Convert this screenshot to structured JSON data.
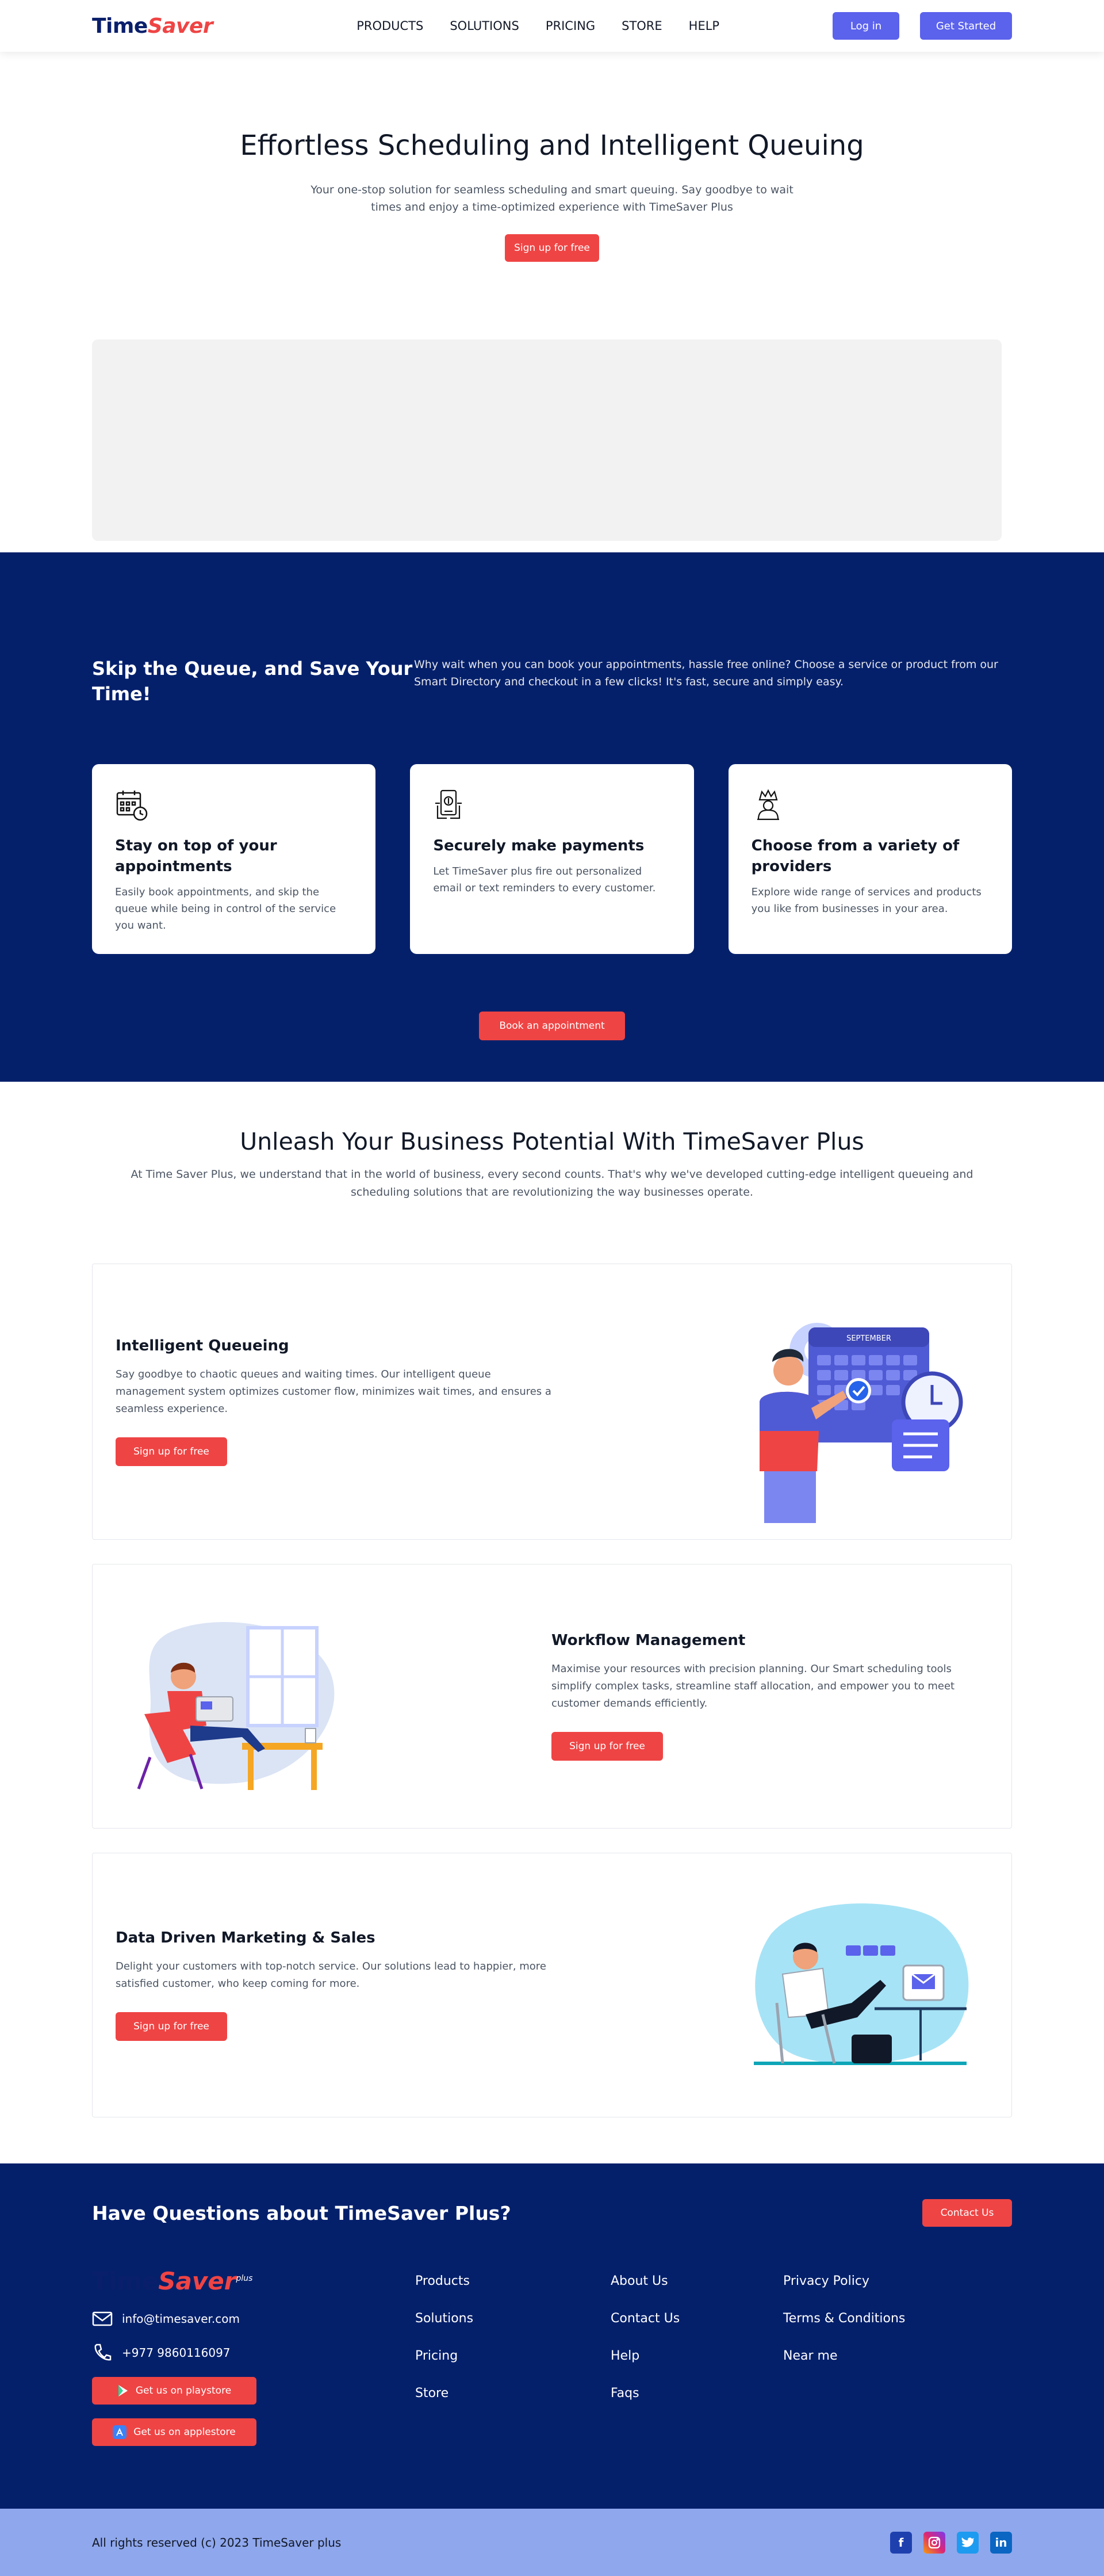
{
  "brand": {
    "part1": "Time",
    "part2": "Saver",
    "suffix": "plus"
  },
  "nav": {
    "items": [
      "PRODUCTS",
      "SOLUTIONS",
      "PRICING",
      "STORE",
      "HELP"
    ],
    "login": "Log in",
    "get_started": "Get Started"
  },
  "hero": {
    "title": "Effortless Scheduling and Intelligent Queuing",
    "subtitle": "Your one-stop solution for seamless scheduling and smart queuing. Say goodbye to wait times and enjoy a time-optimized experience with TimeSaver Plus",
    "cta": "Sign up for free"
  },
  "band": {
    "title": "Skip the Queue, and Save Your Time!",
    "description": "Why wait when you can book your appointments, hassle free online? Choose a service or product from our Smart Directory and checkout in a few clicks! It's fast, secure and simply easy.",
    "cards": [
      {
        "title": "Stay on top of your appointments",
        "text": "Easily book appointments, and skip the queue while being in control of the service you want.",
        "icon": "calendar-clock-icon"
      },
      {
        "title": "Securely make payments",
        "text": "Let TimeSaver plus fire out personalized email or text reminders to every customer.",
        "icon": "secure-payment-icon"
      },
      {
        "title": "Choose from a variety of providers",
        "text": "Explore wide range of services and products you like from businesses in your area.",
        "icon": "provider-icon"
      }
    ],
    "cta": "Book an appointment"
  },
  "unleash": {
    "title": "Unleash Your Business Potential With TimeSaver Plus",
    "subtitle": "At Time Saver Plus, we understand that in the world of business, every second counts. That's why we've developed cutting-edge intelligent queueing and scheduling solutions that are revolutionizing the way businesses operate."
  },
  "features": [
    {
      "title": "Intelligent Queueing",
      "text": "Say goodbye to chaotic queues and waiting times. Our intelligent queue management system optimizes customer flow, minimizes wait times, and ensures a seamless experience.",
      "cta": "Sign up for free"
    },
    {
      "title": "Workflow Management",
      "text": "Maximise your resources with precision planning. Our Smart scheduling tools simplify complex tasks, streamline staff allocation, and empower you to meet customer demands efficiently.",
      "cta": "Sign up for free"
    },
    {
      "title": "Data Driven Marketing & Sales",
      "text": "Delight your customers with top-notch service. Our solutions lead to happier, more satisfied customer, who keep coming for more.",
      "cta": "Sign up for free"
    }
  ],
  "illustration_calendar_month": "SEPTEMBER",
  "footer": {
    "question": "Have Questions about TimeSaver Plus?",
    "contact_btn": "Contact Us",
    "email": "info@timesaver.com",
    "phone": "+977 9860116097",
    "playstore": "Get us on playstore",
    "applestore": "Get us on applestore",
    "col1": [
      "Products",
      "Solutions",
      "Pricing",
      "Store"
    ],
    "col2": [
      "About Us",
      "Contact Us",
      "Help",
      "Faqs"
    ],
    "col3": [
      "Privacy Policy",
      "Terms & Conditions",
      "Near me"
    ],
    "copyright": "All rights reserved (c) 2023 TimeSaver plus"
  },
  "colors": {
    "navy": "#05206b",
    "red": "#ef4444",
    "indigo": "#5b62ec",
    "bottom_bar": "#8fa7ec"
  }
}
